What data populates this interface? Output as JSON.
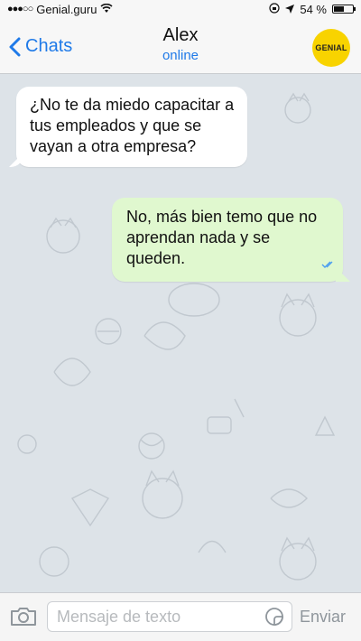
{
  "status_bar": {
    "signal": "●●●○○",
    "carrier": "Genial.guru",
    "battery_percent": "54 %",
    "battery_level": 0.54
  },
  "header": {
    "back_label": "Chats",
    "title": "Alex",
    "subtitle": "online",
    "logo_text": "GENIAL"
  },
  "messages": [
    {
      "direction": "incoming",
      "text": "¿No te da miedo capacitar a tus empleados y que se vayan a otra empresa?"
    },
    {
      "direction": "outgoing",
      "text": "No, más bien temo que no aprendan nada y se queden.",
      "status": "read-double-check"
    }
  ],
  "composer": {
    "placeholder": "Mensaje de texto",
    "value": "",
    "send_label": "Enviar"
  },
  "colors": {
    "accent": "#1f7ae8",
    "outgoing_bubble": "#e0f8cf",
    "incoming_bubble": "#ffffff",
    "logo": "#f8d300"
  },
  "icons": [
    "wifi-icon",
    "orientation-lock-icon",
    "location-arrow-icon",
    "battery-icon",
    "chevron-left-icon",
    "camera-icon",
    "sticker-icon",
    "double-check-icon"
  ]
}
